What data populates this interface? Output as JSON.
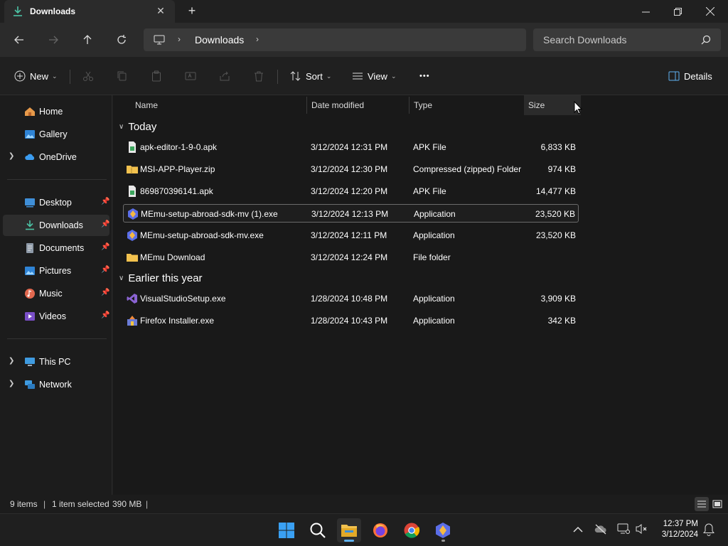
{
  "window": {
    "tab_title": "Downloads",
    "new_tab": "+"
  },
  "address": {
    "crumb": "Downloads",
    "sep": "›",
    "search_placeholder": "Search Downloads"
  },
  "commands": {
    "new": "New",
    "sort": "Sort",
    "view": "View",
    "more": "•••",
    "details": "Details"
  },
  "nav": {
    "items": [
      {
        "label": "Home"
      },
      {
        "label": "Gallery"
      },
      {
        "label": "OneDrive"
      },
      {
        "label": "Desktop"
      },
      {
        "label": "Downloads"
      },
      {
        "label": "Documents"
      },
      {
        "label": "Pictures"
      },
      {
        "label": "Music"
      },
      {
        "label": "Videos"
      },
      {
        "label": "This PC"
      },
      {
        "label": "Network"
      }
    ]
  },
  "columns": {
    "name": "Name",
    "date": "Date modified",
    "type": "Type",
    "size": "Size"
  },
  "groups": {
    "today": "Today",
    "earlier": "Earlier this year"
  },
  "files": [
    {
      "name": "apk-editor-1-9-0.apk",
      "date": "3/12/2024 12:31 PM",
      "type": "APK File",
      "size": "6,833 KB"
    },
    {
      "name": "MSI-APP-Player.zip",
      "date": "3/12/2024 12:30 PM",
      "type": "Compressed (zipped) Folder",
      "size": "974 KB"
    },
    {
      "name": "869870396141.apk",
      "date": "3/12/2024 12:20 PM",
      "type": "APK File",
      "size": "14,477 KB"
    },
    {
      "name": "MEmu-setup-abroad-sdk-mv (1).exe",
      "date": "3/12/2024 12:13 PM",
      "type": "Application",
      "size": "23,520 KB"
    },
    {
      "name": "MEmu-setup-abroad-sdk-mv.exe",
      "date": "3/12/2024 12:11 PM",
      "type": "Application",
      "size": "23,520 KB"
    },
    {
      "name": "MEmu Download",
      "date": "3/12/2024 12:24 PM",
      "type": "File folder",
      "size": ""
    },
    {
      "name": "VisualStudioSetup.exe",
      "date": "1/28/2024 10:48 PM",
      "type": "Application",
      "size": "3,909 KB"
    },
    {
      "name": "Firefox Installer.exe",
      "date": "1/28/2024 10:43 PM",
      "type": "Application",
      "size": "342 KB"
    }
  ],
  "status": {
    "items": "9 items",
    "sep": "|",
    "selected": "1 item selected",
    "selected_size": "390 MB"
  },
  "clock": {
    "time": "12:37 PM",
    "date": "3/12/2024"
  },
  "colors": {
    "accent": "#5fb2f2",
    "folder": "#f2c14e"
  }
}
